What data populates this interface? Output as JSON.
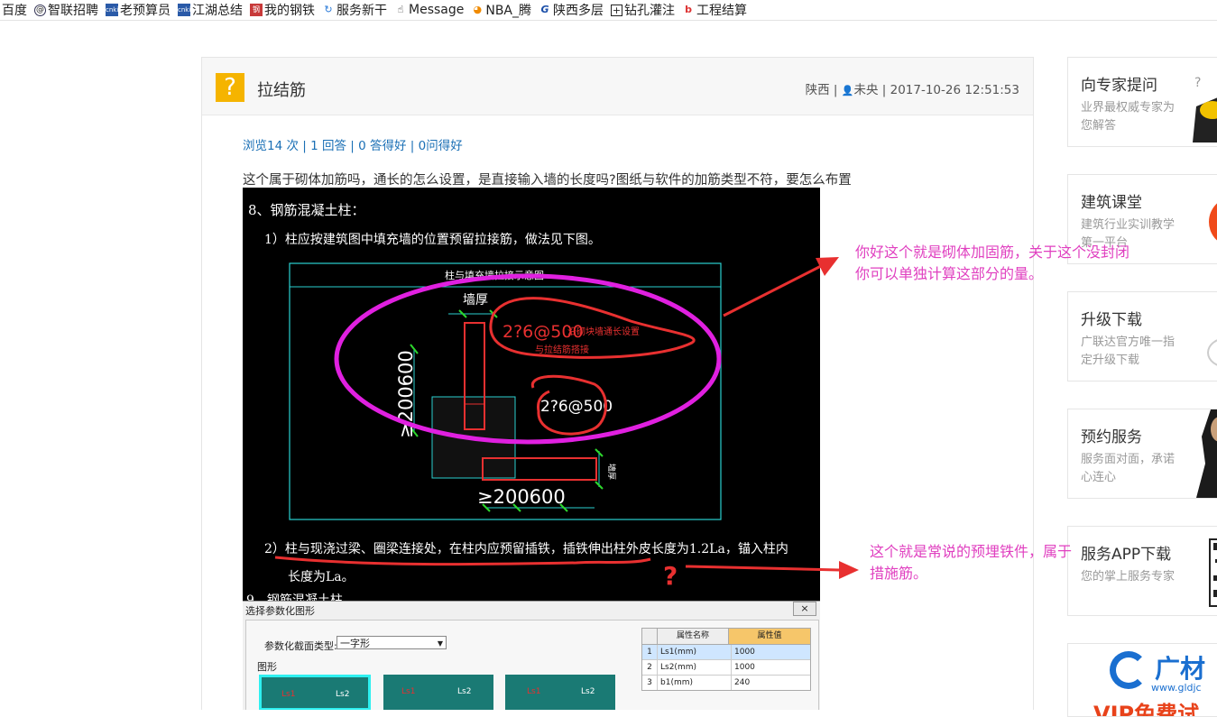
{
  "bookmarks": [
    {
      "label": "百度",
      "icon": "paw-icon"
    },
    {
      "label": "智联招聘",
      "icon": "globe-icon"
    },
    {
      "label": "老预算员",
      "icon": "site-icon"
    },
    {
      "label": "江湖总结",
      "icon": "site-icon"
    },
    {
      "label": "我的钢铁",
      "icon": "site-icon"
    },
    {
      "label": "服务新干",
      "icon": "refresh-icon"
    },
    {
      "label": "Message",
      "icon": "hand-icon"
    },
    {
      "label": "NBA_腾",
      "icon": "tencent-icon"
    },
    {
      "label": "陕西多层",
      "icon": "g-icon"
    },
    {
      "label": "钻孔灌注",
      "icon": "plus-icon"
    },
    {
      "label": "工程结算",
      "icon": "b-icon"
    }
  ],
  "question": {
    "title": "拉结筋",
    "region": "陕西",
    "user": "未央",
    "datetime": "2017-10-26 12:51:53",
    "stats": "浏览14 次 | 1 回答 | 0 答得好 | 0问得好",
    "text": "这个属于砌体加筋吗，通长的怎么设置，是直接输入墙的长度吗?图纸与软件的加筋类型不符，要怎么布置"
  },
  "cad": {
    "heading": "8、钢筋混凝土柱：",
    "item1": "1）柱应按建筑图中填充墙的位置预留拉接筋，做法见下图。",
    "box_title": "柱与填充墙拉接示意图",
    "wall_thickness": "墙厚",
    "rebar1_a": "2?6@500",
    "rebar1_b": "沿砌块墙通长设置",
    "rebar1_c": "与拉结筋搭接",
    "rebar2": "2?6@500",
    "dim_vertical": "≥200600",
    "dim_horizontal": "≥200600",
    "wall_label": "墙厚",
    "item2_a": "2）柱与现浇过梁、圈梁连接处，在柱内应预留插铁，插铁伸出柱外皮长度为1.2La，锚入柱内",
    "item2_b": "长度为La。",
    "item3": "9、钢筋混凝土柱"
  },
  "annotations": {
    "note1": [
      "你好这个就是砌体加固筋，关于这个没封闭",
      "你可以单独计算这部分的量。"
    ],
    "note2": [
      "这个就是常说的预埋铁件，属于",
      "措施筋。"
    ],
    "colors": {
      "ink": "#e040c0",
      "arrow": "#e83030",
      "ellipse": "#e020e0"
    }
  },
  "dialog": {
    "title": "选择参数化图形",
    "close": "×",
    "section_type_label": "参数化截面类型:",
    "section_type_value": "一字形",
    "shape_label": "图形",
    "shape_ls1": "Ls1",
    "shape_ls2": "Ls2",
    "table_headers": [
      "属性名称",
      "属性值"
    ],
    "table_rows": [
      {
        "n": "1",
        "name": "Ls1(mm)",
        "value": "1000"
      },
      {
        "n": "2",
        "name": "Ls2(mm)",
        "value": "1000"
      },
      {
        "n": "3",
        "name": "b1(mm)",
        "value": "240"
      }
    ]
  },
  "sidebar": [
    {
      "title": "向专家提问",
      "desc": "业界最权威专家为您解答",
      "icon": "expert-icon"
    },
    {
      "title": "建筑课堂",
      "desc": "建筑行业实训教学第一平台",
      "icon": "class-icon"
    },
    {
      "title": "升级下载",
      "desc": "广联达官方唯一指定升级下载",
      "icon": "download-icon"
    },
    {
      "title": "预约服务",
      "desc": "服务面对面，承诺心连心",
      "icon": "person-icon"
    },
    {
      "title": "服务APP下载",
      "desc": "您的掌上服务专家",
      "icon": "qr-icon"
    }
  ],
  "banner": {
    "brand": "广材",
    "url": "www.gldjc",
    "promo": "VIP免费试"
  }
}
